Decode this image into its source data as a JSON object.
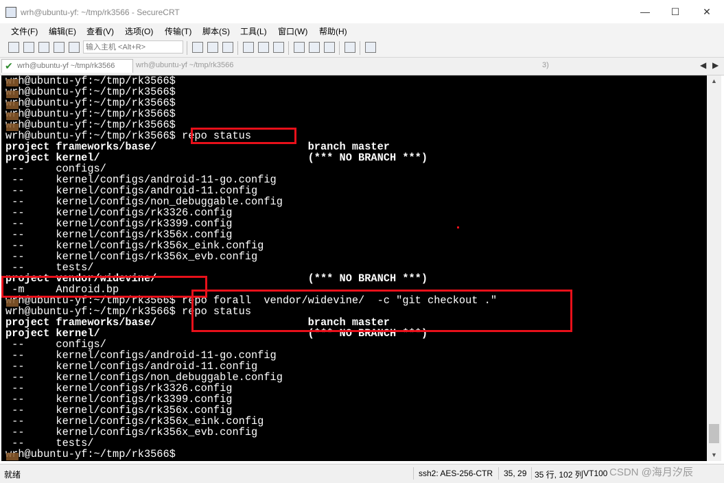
{
  "window": {
    "title": "wrh@ubuntu-yf: ~/tmp/rk3566 - SecureCRT",
    "minimize": "—",
    "maximize": "☐",
    "close": "✕"
  },
  "menu": [
    "文件(F)",
    "编辑(E)",
    "查看(V)",
    "选项(O)",
    "传输(T)",
    "脚本(S)",
    "工具(L)",
    "窗口(W)",
    "帮助(H)"
  ],
  "toolbar": {
    "host_placeholder": "输入主机 <Alt+R>"
  },
  "tabs": {
    "active_label": "wrh@ubuntu-yf ~/tmp/rk3566",
    "second_label": "wrh@ubuntu-yf ~/tmp/rk3566",
    "more_label": "3)",
    "prev": "◀",
    "next": "▶"
  },
  "terminal": {
    "lines": [
      {
        "text": "wrh@ubuntu-yf:~/tmp/rk3566$",
        "bold": false
      },
      {
        "text": "wrh@ubuntu-yf:~/tmp/rk3566$",
        "bold": false
      },
      {
        "text": "wrh@ubuntu-yf:~/tmp/rk3566$",
        "bold": false
      },
      {
        "text": "wrh@ubuntu-yf:~/tmp/rk3566$",
        "bold": false
      },
      {
        "text": "wrh@ubuntu-yf:~/tmp/rk3566$",
        "bold": false
      },
      {
        "text": "wrh@ubuntu-yf:~/tmp/rk3566$ repo status",
        "bold": false
      },
      {
        "text": "project frameworks/base/                        branch master",
        "bold": true
      },
      {
        "text": "project kernel/                                 (*** NO BRANCH ***)",
        "bold": true
      },
      {
        "text": " --     configs/",
        "bold": false
      },
      {
        "text": " --     kernel/configs/android-11-go.config",
        "bold": false
      },
      {
        "text": " --     kernel/configs/android-11.config",
        "bold": false
      },
      {
        "text": " --     kernel/configs/non_debuggable.config",
        "bold": false
      },
      {
        "text": " --     kernel/configs/rk3326.config",
        "bold": false
      },
      {
        "text": " --     kernel/configs/rk3399.config",
        "bold": false
      },
      {
        "text": " --     kernel/configs/rk356x.config",
        "bold": false
      },
      {
        "text": " --     kernel/configs/rk356x_eink.config",
        "bold": false
      },
      {
        "text": " --     kernel/configs/rk356x_evb.config",
        "bold": false
      },
      {
        "text": " --     tests/",
        "bold": false
      },
      {
        "text": "project vendor/widevine/                        (*** NO BRANCH ***)",
        "bold": true
      },
      {
        "text": " -m     Android.bp",
        "bold": false
      },
      {
        "text": "wrh@ubuntu-yf:~/tmp/rk3566$ repo forall  vendor/widevine/  -c \"git checkout .\"",
        "bold": false
      },
      {
        "text": "wrh@ubuntu-yf:~/tmp/rk3566$ repo status",
        "bold": false
      },
      {
        "text": "project frameworks/base/                        branch master",
        "bold": true
      },
      {
        "text": "project kernel/                                 (*** NO BRANCH ***)",
        "bold": true
      },
      {
        "text": " --     configs/",
        "bold": false
      },
      {
        "text": " --     kernel/configs/android-11-go.config",
        "bold": false
      },
      {
        "text": " --     kernel/configs/android-11.config",
        "bold": false
      },
      {
        "text": " --     kernel/configs/non_debuggable.config",
        "bold": false
      },
      {
        "text": " --     kernel/configs/rk3326.config",
        "bold": false
      },
      {
        "text": " --     kernel/configs/rk3399.config",
        "bold": false
      },
      {
        "text": " --     kernel/configs/rk356x.config",
        "bold": false
      },
      {
        "text": " --     kernel/configs/rk356x_eink.config",
        "bold": false
      },
      {
        "text": " --     kernel/configs/rk356x_evb.config",
        "bold": false
      },
      {
        "text": " --     tests/",
        "bold": false
      },
      {
        "text": "wrh@ubuntu-yf:~/tmp/rk3566$",
        "bold": false
      }
    ],
    "highlight_color": "#e8101a"
  },
  "status": {
    "ready": "就绪",
    "cipher": "ssh2: AES-256-CTR",
    "cursor": "35, 29",
    "size": "35 行, 102 列",
    "term": "VT100",
    "watermark": "CSDN @海月汐辰"
  }
}
